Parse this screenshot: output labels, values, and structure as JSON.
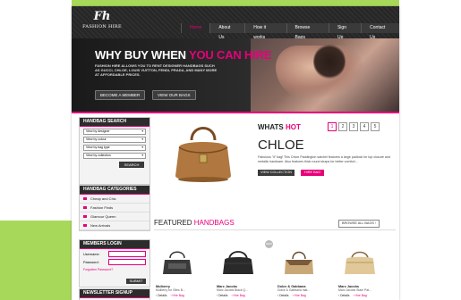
{
  "brand": {
    "logo_mark": "Fh",
    "logo_text": "FASHION HIRE"
  },
  "nav": [
    {
      "label": "Home",
      "active": true
    },
    {
      "label": "About Us",
      "active": false
    },
    {
      "label": "How it works",
      "active": false
    },
    {
      "label": "Browse Bags",
      "active": false
    },
    {
      "label": "Sign Up",
      "active": false
    },
    {
      "label": "Contact Us",
      "active": false
    }
  ],
  "hero": {
    "title_part1": "WHY BUY WHEN ",
    "title_part2": "YOU CAN HIRE",
    "text": "FASHION HIRE ALLOWS YOU TO RENT DESIGNER HANDBAGS SUCH AS GUCCI, CHLOE, LOUIS VUITTON, FENDI, PRADA, AND MANY MORE AT AFFORDABLE PRICES.",
    "btn_member": "BECOME A MEMBER",
    "btn_bags": "VIEW OUR BAGS"
  },
  "search": {
    "heading": "HANDBAG SEARCH",
    "selects": [
      "View by designer",
      "View by colour",
      "View by bag type",
      "View by collection"
    ],
    "button": "SEARCH"
  },
  "categories": {
    "heading": "HANDBAG CATEGORIES",
    "items": [
      "Cheap and Chic",
      "Fashion Finds",
      "Glamour Queen",
      "New Arrivals"
    ]
  },
  "login": {
    "heading": "MEMBERS LOGIN",
    "username_label": "Username:",
    "password_label": "Password:",
    "forgot": "Forgotten Password?",
    "submit": "SUBMIT"
  },
  "newsletter": {
    "heading": "NEWSLETTER SIGNUP"
  },
  "whats_hot": {
    "label_part1": "WHATS ",
    "label_part2": "HOT",
    "pages": [
      "1",
      "2",
      "3",
      "4",
      "5"
    ],
    "active_page": "1",
    "title": "CHLOE",
    "description": "Fabulous \"it\" bag! This Chloe Paddington satchel features a large padlock for top closure and metallic hardware. Also features thick round straps for better comfort...",
    "view_collection": "VIEW COLLECTION",
    "hire_bag": "HIRE BAG"
  },
  "featured": {
    "label_part1": "FEATURED ",
    "label_part2": "HANDBAGS",
    "browse_all": "BROWSE ALL BAGS",
    "new_badge": "NEW",
    "products": [
      {
        "name": "Mulberry",
        "sub": "Mulberry for Giles B...",
        "details": "Details",
        "hire": "Hire Bag"
      },
      {
        "name": "Marc Jacobs",
        "sub": "Marc Jacobs Black Q...",
        "details": "Details",
        "hire": "Hire Bag"
      },
      {
        "name": "Dolce & Gabbana",
        "sub": "Dolce & Gabbana mat...",
        "details": "Details",
        "hire": "Hire Bag"
      },
      {
        "name": "Marc Jacobs",
        "sub": "Marc Jacobs Stam Pat...",
        "details": "Details",
        "hire": "Hire Bag"
      }
    ]
  },
  "colors": {
    "accent": "#e8007a",
    "dark": "#2c2c2c",
    "frame_green": "#a8d85a"
  }
}
